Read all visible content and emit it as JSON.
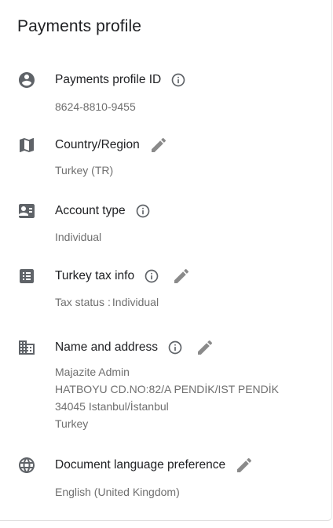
{
  "page": {
    "title": "Payments profile"
  },
  "sections": {
    "profile_id": {
      "label": "Payments profile ID",
      "value": "8624-8810-9455",
      "icon": "account-circle-icon"
    },
    "country": {
      "label": "Country/Region",
      "value": "Turkey (TR)",
      "icon": "map-icon"
    },
    "account_type": {
      "label": "Account type",
      "value": "Individual",
      "icon": "contact-card-icon"
    },
    "tax_info": {
      "label": "Turkey tax info",
      "status_label": "Tax status",
      "status_separator": ":",
      "status_value": "Individual",
      "icon": "list-icon"
    },
    "name_address": {
      "label": "Name and address",
      "lines": [
        "Majazite Admin",
        "HATBOYU CD.NO:82/A PENDİK/IST PENDİK",
        "34045 Istanbul/İstanbul",
        "Turkey"
      ],
      "icon": "business-icon"
    },
    "language": {
      "label": "Document language preference",
      "value": "English (United Kingdom)",
      "icon": "globe-icon"
    }
  },
  "colors": {
    "text_primary": "#202124",
    "text_secondary": "#6f6f6f",
    "icon": "#5f6368",
    "edit_icon": "#8a8a8a"
  }
}
